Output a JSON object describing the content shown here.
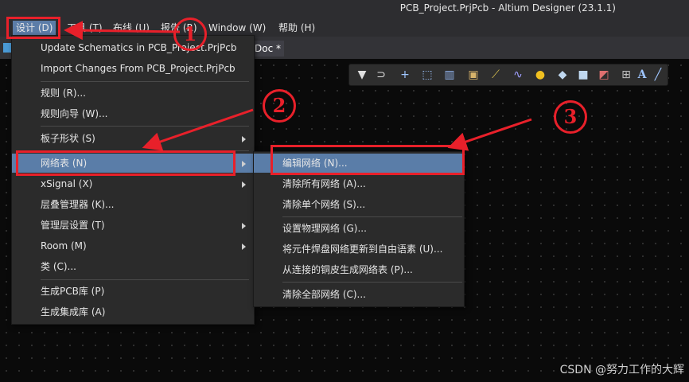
{
  "window": {
    "title": "PCB_Project.PrjPcb - Altium Designer (23.1.1)"
  },
  "menubar": {
    "items": [
      {
        "label": "设计 (D)"
      },
      {
        "label": "工具 (T)"
      },
      {
        "label": "布线 (U)"
      },
      {
        "label": "报告 (R)"
      },
      {
        "label": "Window (W)"
      },
      {
        "label": "帮助 (H)"
      }
    ]
  },
  "tabs": {
    "doc_label": "Doc *"
  },
  "design_menu": {
    "items": [
      {
        "label": "Update Schematics in PCB_Project.PrjPcb"
      },
      {
        "label": "Import Changes From PCB_Project.PrjPcb"
      },
      {
        "label": "规则 (R)..."
      },
      {
        "label": "规则向导 (W)..."
      },
      {
        "label": "板子形状 (S)"
      },
      {
        "label": "网络表 (N)"
      },
      {
        "label": "xSignal (X)"
      },
      {
        "label": "层叠管理器 (K)..."
      },
      {
        "label": "管理层设置 (T)"
      },
      {
        "label": "Room (M)"
      },
      {
        "label": "类 (C)..."
      },
      {
        "label": "生成PCB库 (P)"
      },
      {
        "label": "生成集成库 (A)"
      }
    ]
  },
  "netlist_menu": {
    "items": [
      {
        "label": "编辑网络 (N)..."
      },
      {
        "label": "清除所有网络 (A)..."
      },
      {
        "label": "清除单个网络 (S)..."
      },
      {
        "label": "设置物理网络 (G)..."
      },
      {
        "label": "将元件焊盘网络更新到自由语素 (U)..."
      },
      {
        "label": "从连接的铜皮生成网络表 (P)..."
      },
      {
        "label": "清除全部网络 (C)..."
      }
    ]
  },
  "annotations": {
    "step1": "1",
    "step2": "2",
    "step3": "3",
    "color": "#e8202a"
  },
  "watermark": "CSDN @努力工作的大辉",
  "toolbar": {
    "icons": [
      "filter-icon",
      "route-icon",
      "plus-icon",
      "select-rect-icon",
      "bar-chart-icon",
      "chip-icon",
      "connect-icon",
      "wave-icon",
      "pin-icon",
      "cube-icon",
      "box-icon",
      "line-graph-icon",
      "dimension-icon",
      "text-icon",
      "line-icon"
    ]
  }
}
